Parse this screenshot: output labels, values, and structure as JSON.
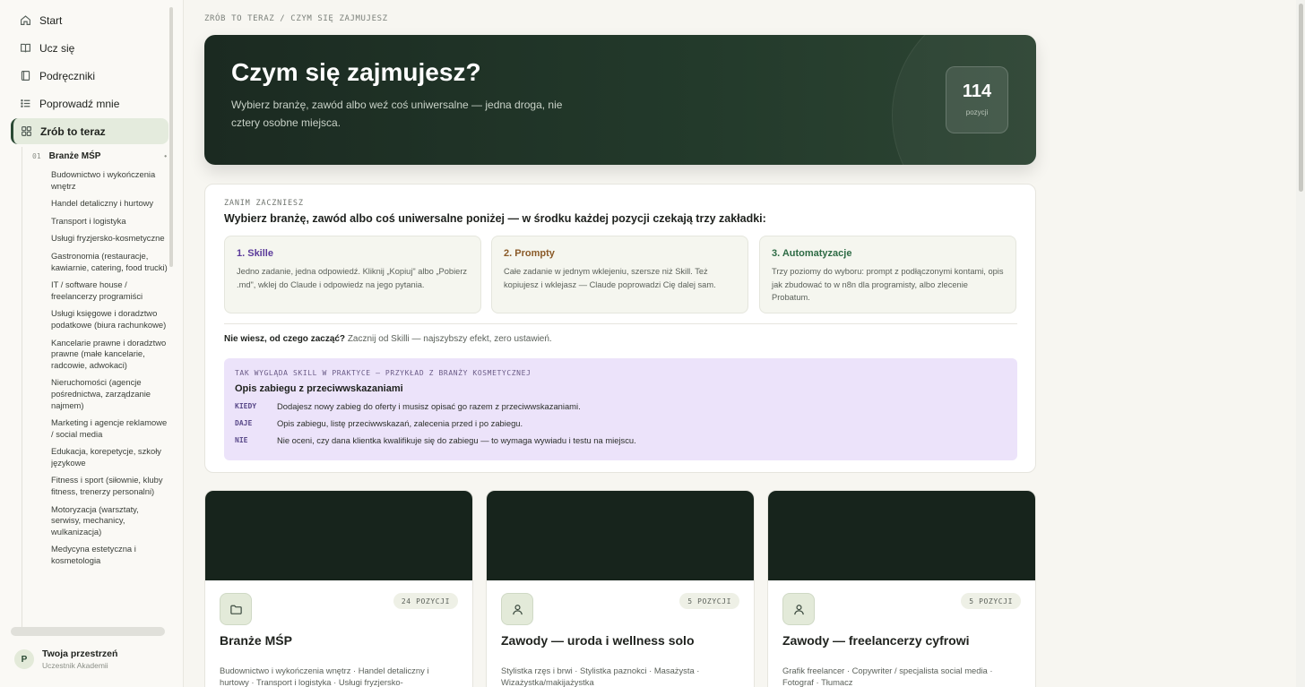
{
  "nav": {
    "items": [
      {
        "label": "Start",
        "icon": "home-icon"
      },
      {
        "label": "Ucz się",
        "icon": "book-open-icon"
      },
      {
        "label": "Podręczniki",
        "icon": "book-icon"
      },
      {
        "label": "Poprowadź mnie",
        "icon": "list-icon"
      },
      {
        "label": "Zrób to teraz",
        "icon": "grid-icon",
        "active": true
      }
    ],
    "sub": {
      "num": "01",
      "label": "Branże MŚP",
      "items": [
        "Budownictwo i wykończenia wnętrz",
        "Handel detaliczny i hurtowy",
        "Transport i logistyka",
        "Usługi fryzjersko-kosmetyczne",
        "Gastronomia (restauracje, kawiarnie, catering, food trucki)",
        "IT / software house / freelancerzy programiści",
        "Usługi księgowe i doradztwo podatkowe (biura rachunkowe)",
        "Kancelarie prawne i doradztwo prawne (małe kancelarie, radcowie, adwokaci)",
        "Nieruchomości (agencje pośrednictwa, zarządzanie najmem)",
        "Marketing i agencje reklamowe / social media",
        "Edukacja, korepetycje, szkoły językowe",
        "Fitness i sport (siłownie, kluby fitness, trenerzy personalni)",
        "Motoryzacja (warsztaty, serwisy, mechanicy, wulkanizacja)",
        "Medycyna estetyczna i kosmetologia"
      ]
    }
  },
  "user": {
    "initial": "P",
    "name": "Twoja przestrzeń",
    "role": "Uczestnik Akademii"
  },
  "breadcrumb": "ZRÓB TO TERAZ / CZYM SIĘ ZAJMUJESZ",
  "hero": {
    "title": "Czym się zajmujesz?",
    "desc": "Wybierz branżę, zawód albo weź coś uniwersalne — jedna droga, nie cztery osobne miejsca.",
    "count": "114",
    "count_label": "pozycji"
  },
  "intro": {
    "eyebrow": "ZANIM ZACZNIESZ",
    "lead": "Wybierz branżę, zawód albo coś uniwersalne poniżej — w środku każdej pozycji czekają trzy zakładki:",
    "tabs": [
      {
        "title": "1. Skille",
        "color": "#5b3a9a",
        "desc": "Jedno zadanie, jedna odpowiedź. Kliknij „Kopiuj\" albo „Pobierz .md\", wklej do Claude i odpowiedz na jego pytania."
      },
      {
        "title": "2. Prompty",
        "color": "#8a5a28",
        "desc": "Całe zadanie w jednym wklejeniu, szersze niż Skill. Też kopiujesz i wklejasz — Claude poprowadzi Cię dalej sam."
      },
      {
        "title": "3. Automatyzacje",
        "color": "#2e6b45",
        "desc": "Trzy poziomy do wyboru: prompt z podłączonymi kontami, opis jak zbudować to w n8n dla programisty, albo zlecenie Probatum."
      }
    ],
    "hint_bold": "Nie wiesz, od czego zacząć?",
    "hint_rest": "Zacznij od Skilli — najszybszy efekt, zero ustawień.",
    "example": {
      "eyebrow": "TAK WYGLĄDA SKILL W PRAKTYCE — PRZYKŁAD Z BRANŻY KOSMETYCZNEJ",
      "title": "Opis zabiegu z przeciwwskazaniami",
      "rows": [
        {
          "key": "KIEDY",
          "value": "Dodajesz nowy zabieg do oferty i musisz opisać go razem z przeciwwskazaniami."
        },
        {
          "key": "DAJE",
          "value": "Opis zabiegu, listę przeciwwskazań, zalecenia przed i po zabiegu."
        },
        {
          "key": "NIE",
          "value": "Nie oceni, czy dana klientka kwalifikuje się do zabiegu — to wymaga wywiadu i testu na miejscu."
        }
      ]
    }
  },
  "cards": [
    {
      "icon": "folder-icon",
      "badge": "24 POZYCJI",
      "title": "Branże MŚP",
      "desc": "Budownictwo i wykończenia wnętrz · Handel detaliczny i hurtowy · Transport i logistyka · Usługi fryzjersko-"
    },
    {
      "icon": "user-icon",
      "badge": "5 POZYCJI",
      "title": "Zawody — uroda i wellness solo",
      "desc": "Stylistka rzęs i brwi · Stylistka paznokci · Masażysta · Wizażystka/makijażystka"
    },
    {
      "icon": "user-icon",
      "badge": "5 POZYCJI",
      "title": "Zawody — freelancerzy cyfrowi",
      "desc": "Grafik freelancer · Copywriter / specjalista social media · Fotograf · Tłumacz"
    }
  ]
}
